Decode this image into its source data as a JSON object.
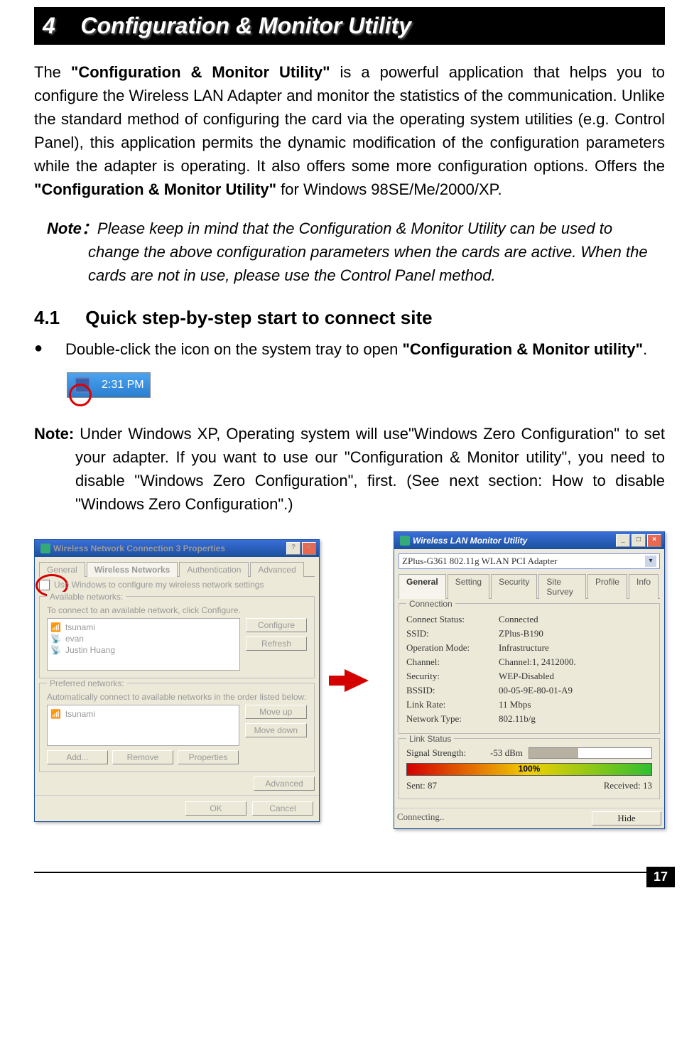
{
  "chapter": {
    "number": "4",
    "title": "Configuration & Monitor Utility"
  },
  "intro": {
    "l1a": "The ",
    "l1b": "\"Configuration & Monitor Utility\"",
    "l1c": " is a powerful application that helps you to configure the Wireless LAN Adapter and monitor the statistics of the communication. Unlike the standard method of configuring the card via the operating system utilities (e.g. Control Panel), this application permits the dynamic modification of the configuration parameters while the adapter is operating. It also offers some more configuration options. Offers the ",
    "l1d": "\"Configuration & Monitor Utility\"",
    "l1e": " for Windows 98SE/Me/2000/XP."
  },
  "note1": {
    "label": "Note：",
    "text": "Please keep in mind that the Configuration & Monitor Utility can be used to change the above configuration parameters when the cards are active. When the cards are not in use, please use the Control Panel method."
  },
  "section41": {
    "num": "4.1",
    "title": "Quick step-by-step start to connect site"
  },
  "bullet": {
    "a": "Double-click the icon on the system tray to open ",
    "b": "\"Configuration & Monitor utility\"",
    "c": "."
  },
  "systray": {
    "time": "2:31 PM"
  },
  "note2": {
    "label": "Note:",
    "text": " Under Windows XP, Operating system will use\"Windows Zero Configuration\" to set your adapter. If you want to use our \"Configuration & Monitor utility\", you need to disable \"Windows Zero Configuration\", first. (See next section: How to disable \"Windows Zero Configuration\".)"
  },
  "wncp": {
    "title": "Wireless Network Connection 3 Properties",
    "tabs": {
      "general": "General",
      "wireless": "Wireless Networks",
      "auth": "Authentication",
      "adv": "Advanced"
    },
    "checkbox": "Use Windows to configure my wireless network settings",
    "avail_label": "Available networks:",
    "avail_hint": "To connect to an available network, click Configure.",
    "avail_items": [
      "tsunami",
      "evan",
      "Justin Huang"
    ],
    "btn_configure": "Configure",
    "btn_refresh": "Refresh",
    "pref_label": "Preferred networks:",
    "pref_hint": "Automatically connect to available networks in the order listed below:",
    "pref_items": [
      "tsunami"
    ],
    "btn_moveup": "Move up",
    "btn_movedown": "Move down",
    "btn_add": "Add...",
    "btn_remove": "Remove",
    "btn_props": "Properties",
    "btn_adv": "Advanced",
    "btn_ok": "OK",
    "btn_cancel": "Cancel"
  },
  "monitor": {
    "title": "Wireless LAN Monitor Utility",
    "adapter": "ZPlus-G361 802.11g WLAN PCI Adapter",
    "tabs": {
      "general": "General",
      "setting": "Setting",
      "security": "Security",
      "survey": "Site Survey",
      "profile": "Profile",
      "info": "Info"
    },
    "conn_legend": "Connection",
    "kv": {
      "status_k": "Connect Status:",
      "status_v": "Connected",
      "ssid_k": "SSID:",
      "ssid_v": "ZPlus-B190",
      "mode_k": "Operation Mode:",
      "mode_v": "Infrastructure",
      "chan_k": "Channel:",
      "chan_v": "Channel:1, 2412000.",
      "sec_k": "Security:",
      "sec_v": "WEP-Disabled",
      "bssid_k": "BSSID:",
      "bssid_v": "00-05-9E-80-01-A9",
      "rate_k": "Link Rate:",
      "rate_v": "11 Mbps",
      "ntype_k": "Network Type:",
      "ntype_v": "802.11b/g"
    },
    "link_legend": "Link Status",
    "sig_k": "Signal Strength:",
    "sig_v": "-53 dBm",
    "qual": "100%",
    "sent": "Sent:   87",
    "recv": "Received:  13",
    "status": "Connecting..",
    "hide": "Hide"
  },
  "page_number": "17"
}
